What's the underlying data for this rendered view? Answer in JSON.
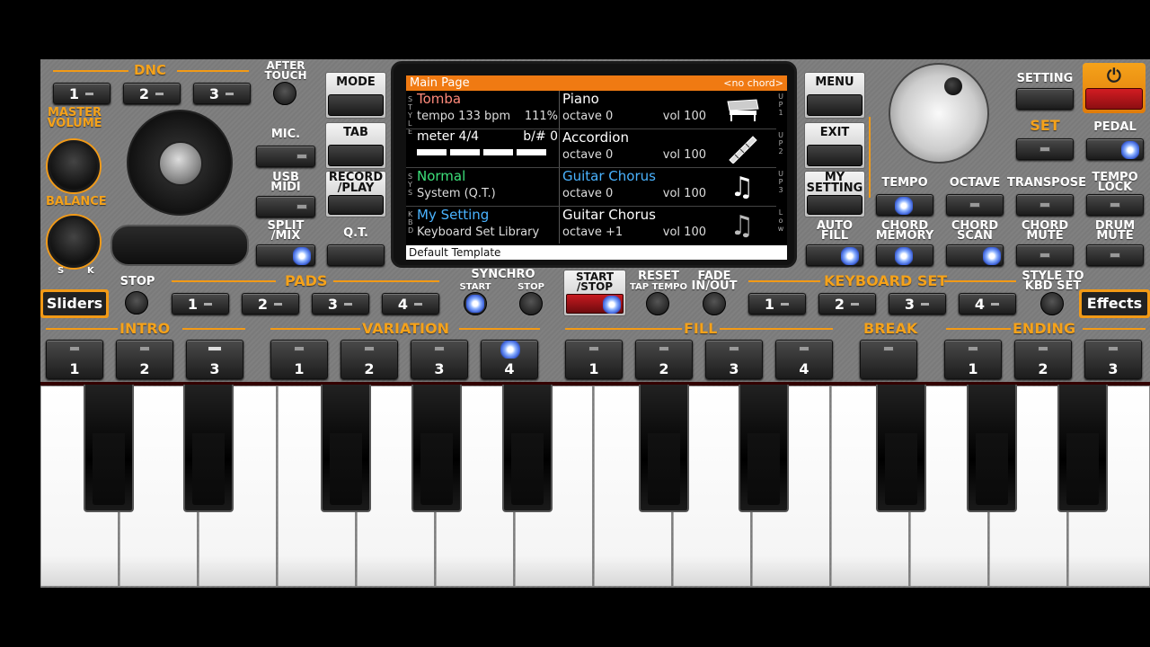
{
  "left_panel": {
    "dnc_label": "DNC",
    "after_touch_label": "AFTER\nTOUCH",
    "dnc_buttons": [
      "1",
      "2",
      "3"
    ],
    "master_volume_label": "MASTER\nVOLUME",
    "balance_label": "BALANCE",
    "balance_min": "S",
    "balance_max": "K",
    "mic_label": "MIC.",
    "usb_midi_label": "USB\nMIDI",
    "split_mix_label": "SPLIT\n/MIX",
    "mode_label": "MODE",
    "tab_label": "TAB",
    "record_play_label": "RECORD\n/PLAY",
    "qt_label": "Q.T."
  },
  "screen": {
    "title": "Main Page",
    "chord": "<no chord>",
    "style_name": "Tomba",
    "tempo": "tempo 133 bpm",
    "percent": "111%",
    "meter": "meter 4/4",
    "bsharp": "b/# 0",
    "sys_name": "Normal",
    "sys_sub": "System (Q.T.)",
    "kbd_name": "My Setting",
    "kbd_sub": "Keyboard Set Library",
    "footer": "Default Template",
    "side_style": "STYLE",
    "side_sys": "SYS",
    "side_kbd": "KBD",
    "parts": [
      {
        "name": "Piano",
        "octave": "octave  0",
        "vol": "vol 100",
        "tag": "UP1",
        "icon": "piano-icon"
      },
      {
        "name": "Accordion",
        "octave": "octave  0",
        "vol": "vol 100",
        "tag": "UP2",
        "icon": "accordion-icon"
      },
      {
        "name": "Guitar Chorus",
        "octave": "octave  0",
        "vol": "vol 100",
        "tag": "UP3",
        "icon": "music-note-icon"
      },
      {
        "name": "Guitar Chorus",
        "octave": "octave +1",
        "vol": "vol 100",
        "tag": "Low",
        "icon": "music-note-icon"
      }
    ],
    "part_tags_text": {
      "up1": "U\nP\n1",
      "up2": "U\nP\n2",
      "up3": "U\nP\n3",
      "low": "L\no\nw"
    }
  },
  "right_panel": {
    "menu_label": "MENU",
    "exit_label": "EXIT",
    "my_setting_label": "MY\nSETTING",
    "auto_fill_label": "AUTO\nFILL",
    "setting_label": "SETTING",
    "set_label": "SET",
    "pedal_label": "PEDAL",
    "tempo_label": "TEMPO",
    "octave_label": "OCTAVE",
    "transpose_label": "TRANSPOSE",
    "tempo_lock_label": "TEMPO\nLOCK",
    "chord_memory_label": "CHORD\nMEMORY",
    "chord_scan_label": "CHORD\nSCAN",
    "chord_mute_label": "CHORD\nMUTE",
    "drum_mute_label": "DRUM\nMUTE"
  },
  "middle_row": {
    "sliders_label": "Sliders",
    "stop_label": "STOP",
    "pads_label": "PADS",
    "pads": [
      "1",
      "2",
      "3",
      "4"
    ],
    "synchro_label": "SYNCHRO",
    "synchro_start": "START",
    "synchro_stop": "STOP",
    "start_stop_label": "START\n/STOP",
    "reset_label": "RESET",
    "tap_tempo_label": "TAP TEMPO",
    "fade_label": "FADE\nIN/OUT",
    "keyboard_set_label": "KEYBOARD SET",
    "kbd_sets": [
      "1",
      "2",
      "3",
      "4"
    ],
    "style_to_kbd_label": "STYLE TO\nKBD SET",
    "effects_label": "Effects"
  },
  "sections": {
    "intro": {
      "label": "INTRO",
      "buttons": [
        "1",
        "2",
        "3"
      ]
    },
    "variation": {
      "label": "VARIATION",
      "buttons": [
        "1",
        "2",
        "3",
        "4"
      ]
    },
    "fill": {
      "label": "FILL",
      "buttons": [
        "1",
        "2",
        "3",
        "4"
      ]
    },
    "break": {
      "label": "BREAK",
      "buttons": [
        ""
      ]
    },
    "ending": {
      "label": "ENDING",
      "buttons": [
        "1",
        "2",
        "3"
      ]
    }
  },
  "colors": {
    "accent": "#f29a16",
    "title_bar": "#f07a12",
    "sys_green": "#3de07a",
    "kbd_blue": "#4ab3ff",
    "style_red": "#ff8a7a",
    "power_red": "#c0141a"
  }
}
